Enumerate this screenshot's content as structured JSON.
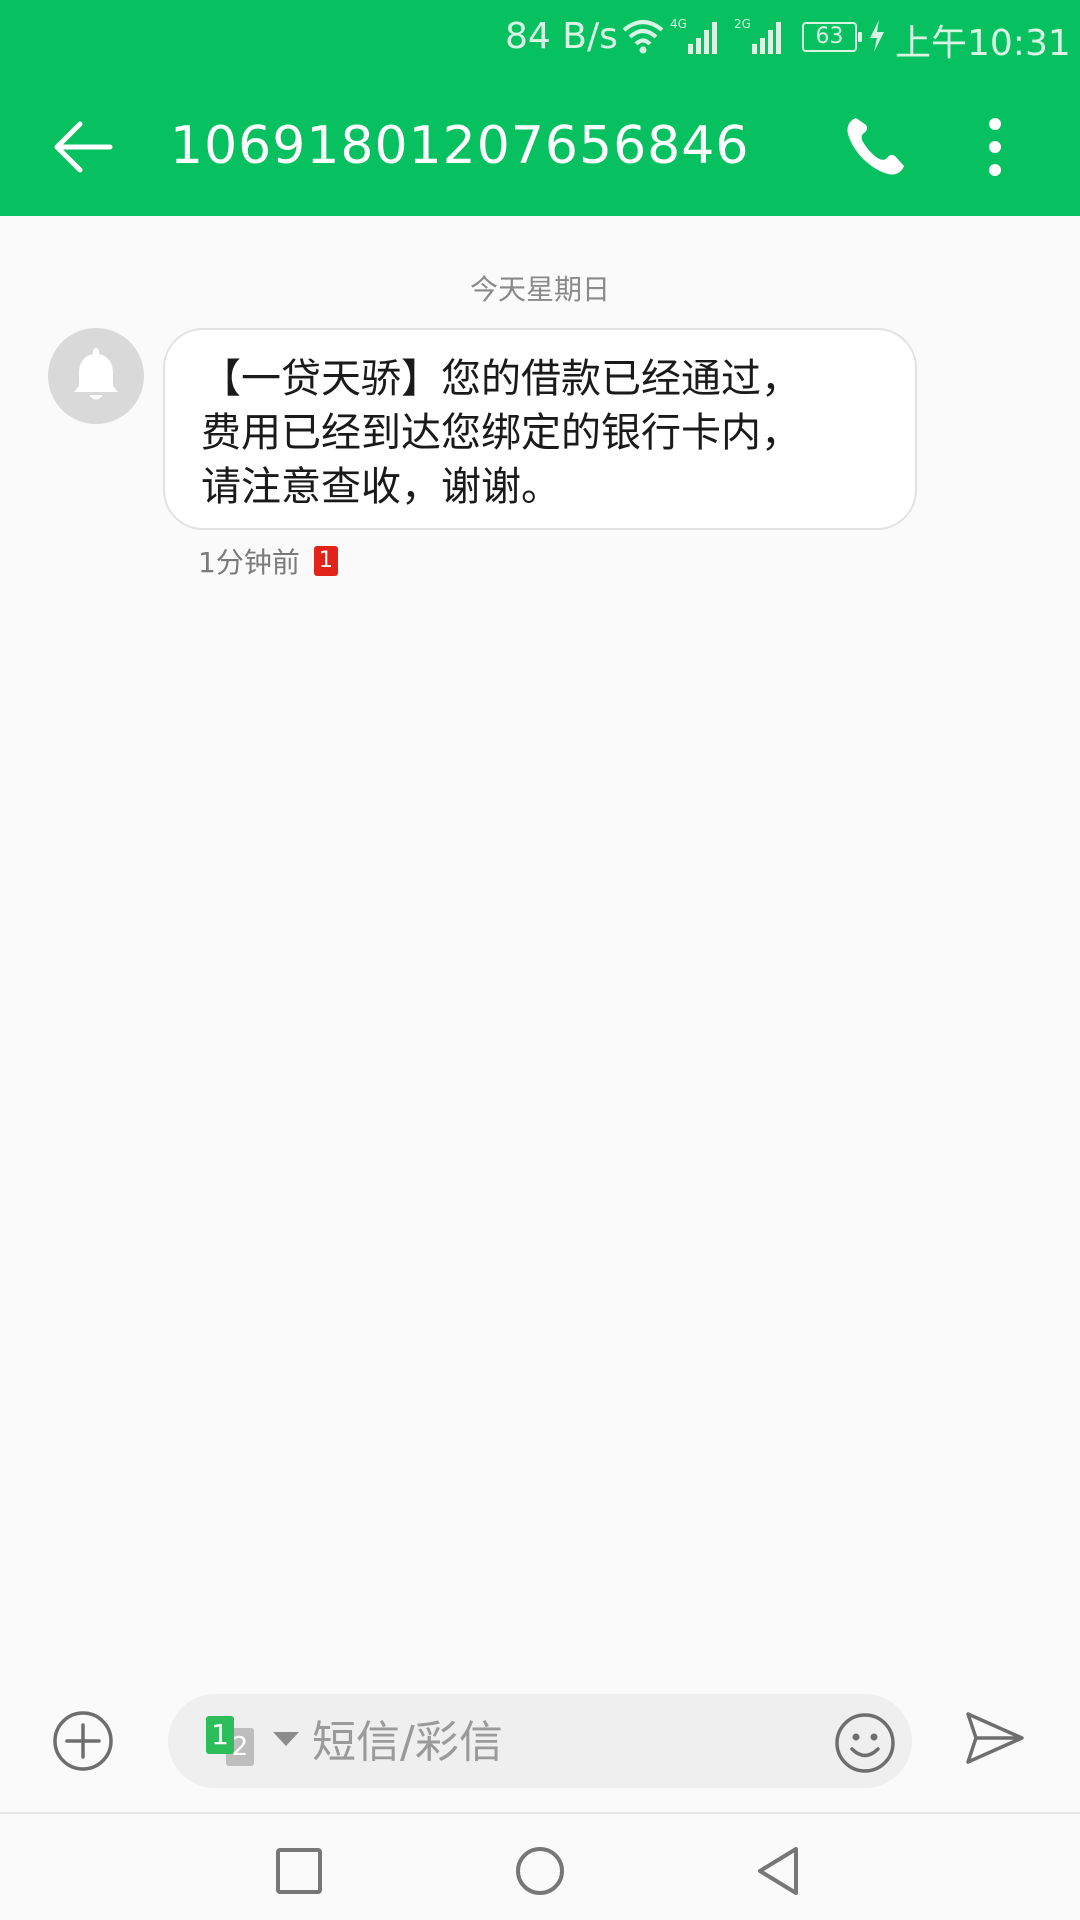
{
  "status_bar": {
    "net_speed": "84 B/s",
    "battery": "63",
    "time": "上午10:31",
    "icons": [
      "wifi-icon",
      "signal-4g-icon",
      "signal-2g-icon",
      "battery-icon",
      "charging-icon"
    ]
  },
  "app_bar": {
    "title": "10691801207656846",
    "back_icon": "back-arrow-icon",
    "call_icon": "phone-icon",
    "more_icon": "more-vert-icon"
  },
  "conversation": {
    "date_separator": "今天星期日",
    "messages": [
      {
        "lines": [
          "【一贷天骄】您的借款已经通过，",
          "费用已经到达您绑定的银行卡内，",
          "请注意查收，谢谢。"
        ],
        "time": "1分钟前",
        "sim": "1",
        "avatar_icon": "bell-icon"
      }
    ]
  },
  "composer": {
    "placeholder": "短信/彩信",
    "sim_primary": "1",
    "sim_secondary": "2"
  },
  "colors": {
    "brand_green": "#07c160",
    "sim_red": "#e2231a",
    "sim_green": "#2dbd5a"
  }
}
